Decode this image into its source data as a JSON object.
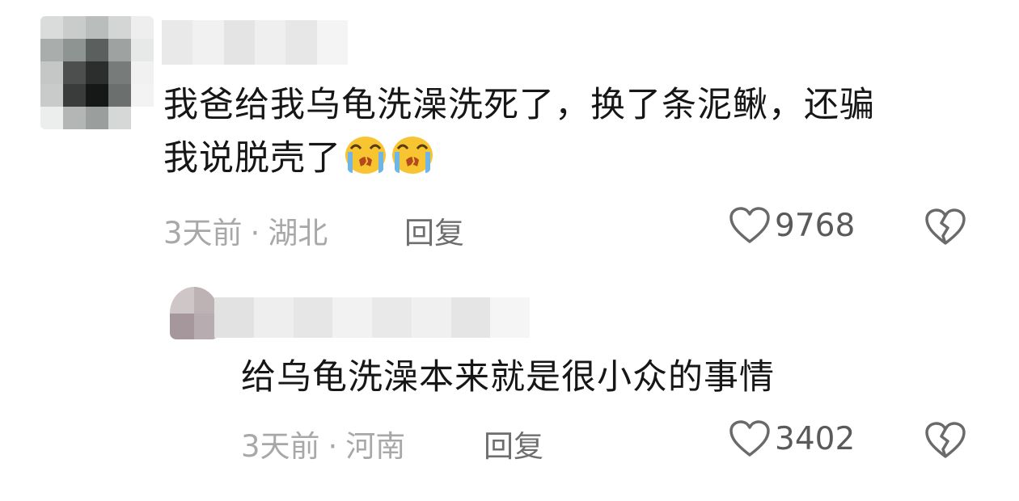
{
  "comments": [
    {
      "text_line1": "我爸给我乌龟洗澡洗死了，换了条泥鳅，还骗",
      "text_line2": "我说脱壳了",
      "emojis": [
        "crying-face-emoji",
        "crying-face-emoji"
      ],
      "time": "3天前",
      "separator": "·",
      "location": "湖北",
      "reply_label": "回复",
      "like_count": "9768",
      "like_icon": "heart-outline-icon",
      "dislike_icon": "broken-heart-icon",
      "author_obscured": true
    },
    {
      "text_line1": "给乌龟洗澡本来就是很小众的事情",
      "time": "3天前",
      "separator": "·",
      "location": "河南",
      "reply_label": "回复",
      "like_count": "3402",
      "like_icon": "heart-outline-icon",
      "dislike_icon": "broken-heart-icon",
      "author_obscured": true
    }
  ],
  "colors": {
    "text_primary": "#161616",
    "text_meta": "#a8a8a8",
    "reply": "#6e6e6e",
    "icon": "#6a6a6a",
    "emoji_face": "#f7c531",
    "emoji_tear": "#6fb6e6"
  }
}
